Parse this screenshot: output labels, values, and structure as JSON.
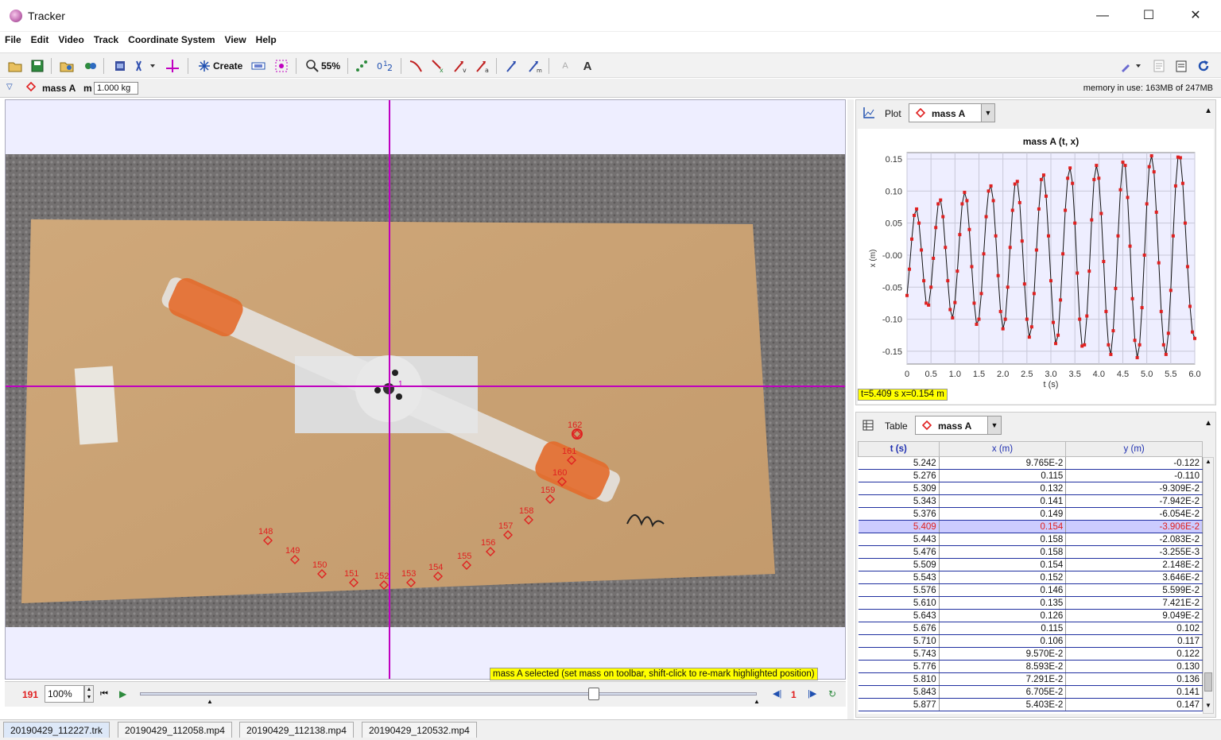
{
  "window": {
    "title": "Tracker",
    "minimize": "—",
    "maximize": "☐",
    "close": "✕"
  },
  "menu": [
    "File",
    "Edit",
    "Video",
    "Track",
    "Coordinate System",
    "View",
    "Help"
  ],
  "toolbar": {
    "create_label": "Create",
    "zoom_label": "55%"
  },
  "track_bar": {
    "track_name": "mass A",
    "mass_label": "m",
    "mass_value": "1.000 kg",
    "memory": "memory in use: 163MB of 247MB"
  },
  "video": {
    "marker_labels": [
      "148",
      "149",
      "150",
      "151",
      "152",
      "153",
      "154",
      "155",
      "156",
      "157",
      "158",
      "159",
      "160",
      "161",
      "162"
    ],
    "origin_label": "1",
    "status_message": "mass A selected (set mass on toolbar, shift-click to re-mark highlighted position)"
  },
  "player": {
    "frame": "191",
    "rate": "100%",
    "step": "1"
  },
  "file_tabs": [
    "20190429_112227.trk",
    "20190429_112058.mp4",
    "20190429_112138.mp4",
    "20190429_120532.mp4"
  ],
  "plot_panel": {
    "header": "Plot",
    "track": "mass A",
    "readout": "t=5.409 s  x=0.154 m"
  },
  "chart_data": {
    "type": "scatter",
    "title": "mass A (t, x)",
    "xlabel": "t (s)",
    "ylabel": "x (m)",
    "xlim": [
      0,
      6.0
    ],
    "ylim": [
      -0.17,
      0.16
    ],
    "x_ticks": [
      "0",
      "0.5",
      "1.0",
      "1.5",
      "2.0",
      "2.5",
      "3.0",
      "3.5",
      "4.0",
      "4.5",
      "5.0",
      "5.5",
      "6.0"
    ],
    "y_ticks": [
      "0.15",
      "0.10",
      "0.05",
      "-0.00",
      "-0.05",
      "-0.10",
      "-0.15"
    ],
    "series": [
      {
        "x": [
          0.0,
          0.05,
          0.1,
          0.15,
          0.2,
          0.25,
          0.3,
          0.35,
          0.4,
          0.45,
          0.5,
          0.55,
          0.6,
          0.65,
          0.7,
          0.75,
          0.8,
          0.85,
          0.9,
          0.95,
          1.0,
          1.05,
          1.1,
          1.15,
          1.2,
          1.25,
          1.3,
          1.35,
          1.4,
          1.45,
          1.5,
          1.55,
          1.6,
          1.65,
          1.7,
          1.75,
          1.8,
          1.85,
          1.9,
          1.95,
          2.0,
          2.05,
          2.1,
          2.15,
          2.2,
          2.25,
          2.3,
          2.35,
          2.4,
          2.45,
          2.5,
          2.55,
          2.6,
          2.65,
          2.7,
          2.75,
          2.8,
          2.85,
          2.9,
          2.95,
          3.0,
          3.05,
          3.1,
          3.15,
          3.2,
          3.25,
          3.3,
          3.35,
          3.4,
          3.45,
          3.5,
          3.55,
          3.6,
          3.65,
          3.7,
          3.75,
          3.8,
          3.85,
          3.9,
          3.95,
          4.0,
          4.05,
          4.1,
          4.15,
          4.2,
          4.25,
          4.3,
          4.35,
          4.4,
          4.45,
          4.5,
          4.55,
          4.6,
          4.65,
          4.7,
          4.75,
          4.8,
          4.85,
          4.9,
          4.95,
          5.0,
          5.05,
          5.1,
          5.15,
          5.2,
          5.25,
          5.3,
          5.35,
          5.4,
          5.45,
          5.5,
          5.55,
          5.6,
          5.65,
          5.7,
          5.75,
          5.8,
          5.85,
          5.9,
          5.95,
          6.0
        ],
        "values": [
          -0.063,
          -0.022,
          0.025,
          0.062,
          0.072,
          0.05,
          0.008,
          -0.04,
          -0.075,
          -0.078,
          -0.05,
          -0.005,
          0.043,
          0.08,
          0.086,
          0.06,
          0.012,
          -0.04,
          -0.085,
          -0.098,
          -0.074,
          -0.025,
          0.032,
          0.08,
          0.098,
          0.085,
          0.04,
          -0.018,
          -0.075,
          -0.108,
          -0.1,
          -0.06,
          0.002,
          0.06,
          0.1,
          0.108,
          0.085,
          0.03,
          -0.032,
          -0.088,
          -0.115,
          -0.1,
          -0.05,
          0.012,
          0.07,
          0.111,
          0.115,
          0.082,
          0.022,
          -0.045,
          -0.1,
          -0.128,
          -0.112,
          -0.06,
          0.008,
          0.072,
          0.118,
          0.125,
          0.092,
          0.03,
          -0.04,
          -0.105,
          -0.138,
          -0.125,
          -0.07,
          0.002,
          0.07,
          0.12,
          0.136,
          0.112,
          0.05,
          -0.028,
          -0.1,
          -0.142,
          -0.14,
          -0.095,
          -0.025,
          0.055,
          0.118,
          0.14,
          0.12,
          0.065,
          -0.01,
          -0.088,
          -0.14,
          -0.155,
          -0.118,
          -0.052,
          0.03,
          0.102,
          0.145,
          0.14,
          0.09,
          0.014,
          -0.068,
          -0.133,
          -0.16,
          -0.14,
          -0.082,
          0.0,
          0.08,
          0.138,
          0.155,
          0.13,
          0.067,
          -0.012,
          -0.088,
          -0.14,
          -0.155,
          -0.122,
          -0.055,
          0.03,
          0.108,
          0.153,
          0.152,
          0.112,
          0.05,
          -0.018,
          -0.08,
          -0.12,
          -0.13
        ],
        "color": "#e02020"
      }
    ]
  },
  "table_panel": {
    "header": "Table",
    "track": "mass A",
    "columns": [
      "t (s)",
      "x (m)",
      "y (m)"
    ],
    "rows": [
      [
        "5.242",
        "9.765E-2",
        "-0.122"
      ],
      [
        "5.276",
        "0.115",
        "-0.110"
      ],
      [
        "5.309",
        "0.132",
        "-9.309E-2"
      ],
      [
        "5.343",
        "0.141",
        "-7.942E-2"
      ],
      [
        "5.376",
        "0.149",
        "-6.054E-2"
      ],
      [
        "5.409",
        "0.154",
        "-3.906E-2"
      ],
      [
        "5.443",
        "0.158",
        "-2.083E-2"
      ],
      [
        "5.476",
        "0.158",
        "-3.255E-3"
      ],
      [
        "5.509",
        "0.154",
        "2.148E-2"
      ],
      [
        "5.543",
        "0.152",
        "3.646E-2"
      ],
      [
        "5.576",
        "0.146",
        "5.599E-2"
      ],
      [
        "5.610",
        "0.135",
        "7.421E-2"
      ],
      [
        "5.643",
        "0.126",
        "9.049E-2"
      ],
      [
        "5.676",
        "0.115",
        "0.102"
      ],
      [
        "5.710",
        "0.106",
        "0.117"
      ],
      [
        "5.743",
        "9.570E-2",
        "0.122"
      ],
      [
        "5.776",
        "8.593E-2",
        "0.130"
      ],
      [
        "5.810",
        "7.291E-2",
        "0.136"
      ],
      [
        "5.843",
        "6.705E-2",
        "0.141"
      ],
      [
        "5.877",
        "5.403E-2",
        "0.147"
      ]
    ],
    "selected_row": 5
  },
  "colors": {
    "axis_magenta": "#c000c0",
    "track_red": "#e02020",
    "highlight_yellow": "#ffff00",
    "board": "#c9a478",
    "carpet": "#6d6a6a"
  }
}
